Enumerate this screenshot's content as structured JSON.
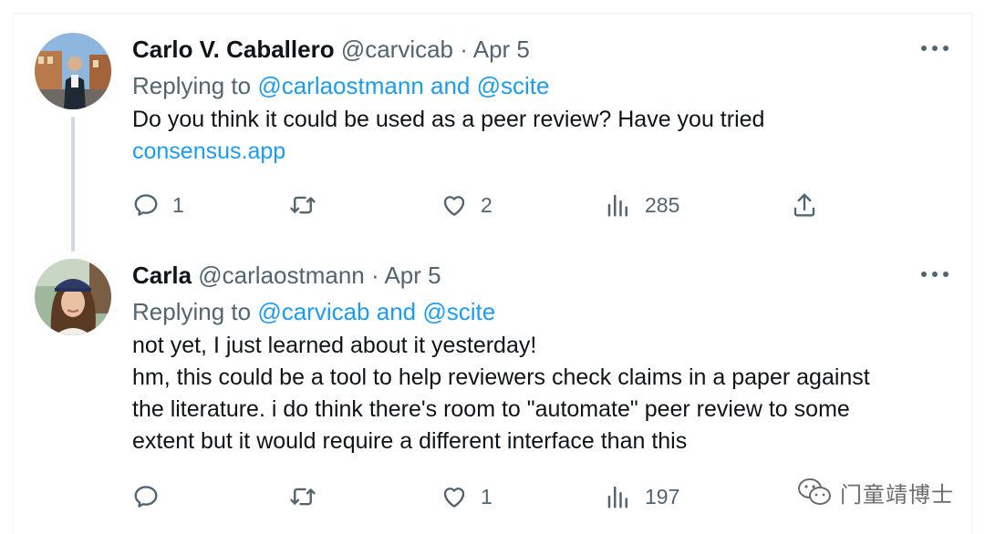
{
  "tweets": [
    {
      "name": "Carlo V. Caballero",
      "handle": "@carvicab",
      "separator": "·",
      "date": "Apr 5",
      "replying_prefix": "Replying to",
      "replying_to": "@carlaostmann and @scite",
      "body_lines": [
        "Do you think it could be used as a peer review? Have you tried"
      ],
      "body_link": "consensus.app",
      "actions": {
        "replies": "1",
        "retweets": "",
        "likes": "2",
        "views": "285"
      },
      "icons": {
        "avatar": "avatar-carlo",
        "reply": "reply-icon",
        "retweet": "retweet-icon",
        "like": "heart-icon",
        "views": "views-icon",
        "share": "share-icon",
        "more": "more-icon"
      }
    },
    {
      "name": "Carla",
      "handle": "@carlaostmann",
      "separator": "·",
      "date": "Apr 5",
      "replying_prefix": "Replying to",
      "replying_to": "@carvicab and @scite",
      "body_lines": [
        "not yet, I just learned about it yesterday!",
        "hm, this could be a tool to help reviewers check claims in a paper against",
        "the literature. i do think  there's room to \"automate\" peer review to some",
        "extent but it would require a different interface than this"
      ],
      "actions": {
        "replies": "",
        "retweets": "",
        "likes": "1",
        "views": "197"
      },
      "icons": {
        "avatar": "avatar-carla",
        "reply": "reply-icon",
        "retweet": "retweet-icon",
        "like": "heart-icon",
        "views": "views-icon",
        "more": "more-icon"
      }
    }
  ],
  "watermark": {
    "text": "门童靖博士",
    "icon": "wechat-icon"
  },
  "colors": {
    "link": "#1d9bf0",
    "secondary": "#536471",
    "text": "#0f1419"
  }
}
